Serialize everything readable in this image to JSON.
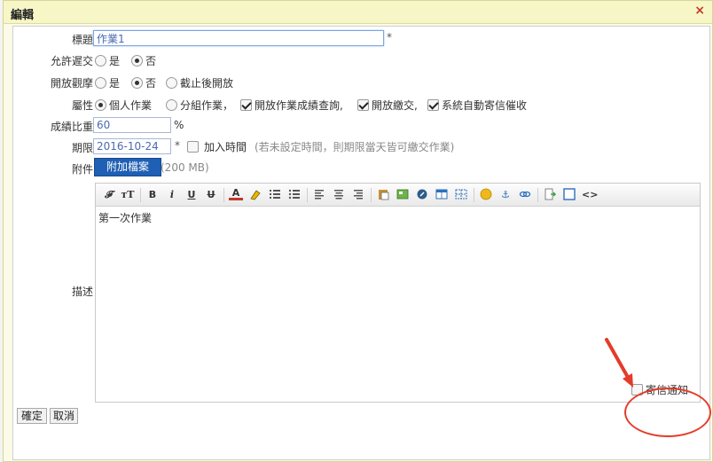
{
  "dialog": {
    "title": "編輯",
    "close": "×"
  },
  "form": {
    "title_label": "標題",
    "title_value": "作業1",
    "required_mark": "*",
    "late_label": "允許遲交",
    "late_yes": "是",
    "late_no": "否",
    "view_label": "開放觀摩",
    "view_yes": "是",
    "view_no": "否",
    "view_after": "截止後開放",
    "attr_label": "屬性",
    "attr_personal": "個人作業",
    "attr_group": "分組作業，",
    "attr_open_grade": "開放作業成績查詢,",
    "attr_open_submit": "開放繳交,",
    "attr_auto_mail": "系統自動寄信催收",
    "weight_label": "成績比重",
    "weight_value": "60",
    "percent": "%",
    "deadline_label": "期限",
    "deadline_value": "2016-10-24",
    "add_time": "加入時間",
    "deadline_hint": "(若未設定時間，則期限當天皆可繳交作業)",
    "attach_label": "附件",
    "attach_button": "附加檔案",
    "attach_size": "(200 MB)",
    "desc_label": "描述",
    "desc_value": "第一次作業"
  },
  "toolbar": {
    "font": "𝓕",
    "size": "тT",
    "bold": "B",
    "italic": "i",
    "underline": "U",
    "strike": "U",
    "color": "A",
    "link": "⚓",
    "code": "<>"
  },
  "footer": {
    "ok": "確定",
    "cancel": "取消",
    "notify": "寄信通知"
  },
  "colors": {
    "annotation": "#e53b2a",
    "primary_button": "#1f5fb4"
  }
}
